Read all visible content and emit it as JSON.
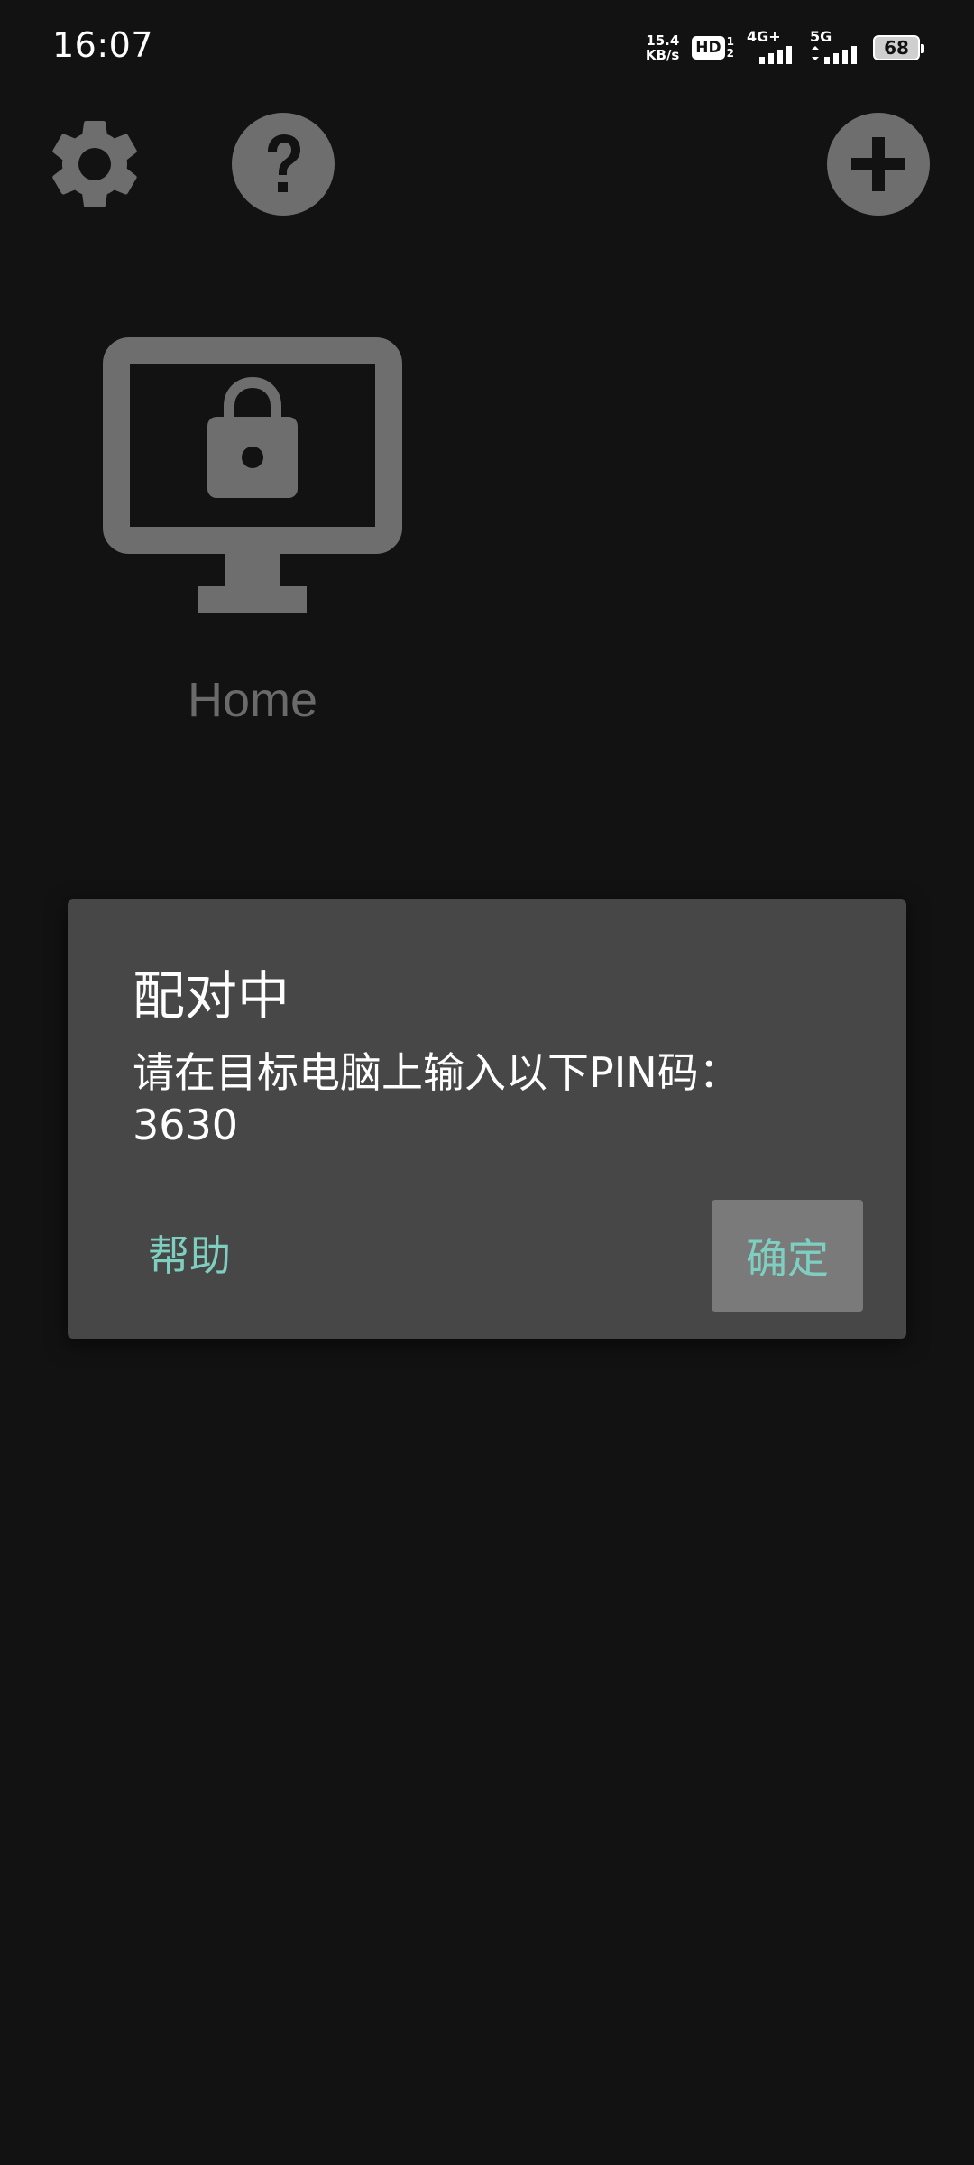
{
  "status_bar": {
    "time": "16:07",
    "net_speed_value": "15.4",
    "net_speed_unit": "KB/s",
    "hd_label": "HD",
    "hd_sub_top": "1",
    "hd_sub_bottom": "2",
    "signal1_label": "4G+",
    "signal2_label": "5G",
    "battery_level": "68"
  },
  "toolbar": {
    "settings_icon": "gear-icon",
    "help_icon": "help-circle-icon",
    "add_icon": "add-circle-icon"
  },
  "pc_list": {
    "items": [
      {
        "name": "Home",
        "icon": "locked-monitor-icon"
      }
    ]
  },
  "dialog": {
    "title": "配对中",
    "message_line1": "请在目标电脑上输入以下PIN码：",
    "pin": "3630",
    "help_label": "帮助",
    "ok_label": "确定",
    "accent_color": "#7fcfc1"
  },
  "colors": {
    "background": "#121212",
    "icon_gray": "#6e6e6e",
    "dialog_bg": "#474747"
  }
}
